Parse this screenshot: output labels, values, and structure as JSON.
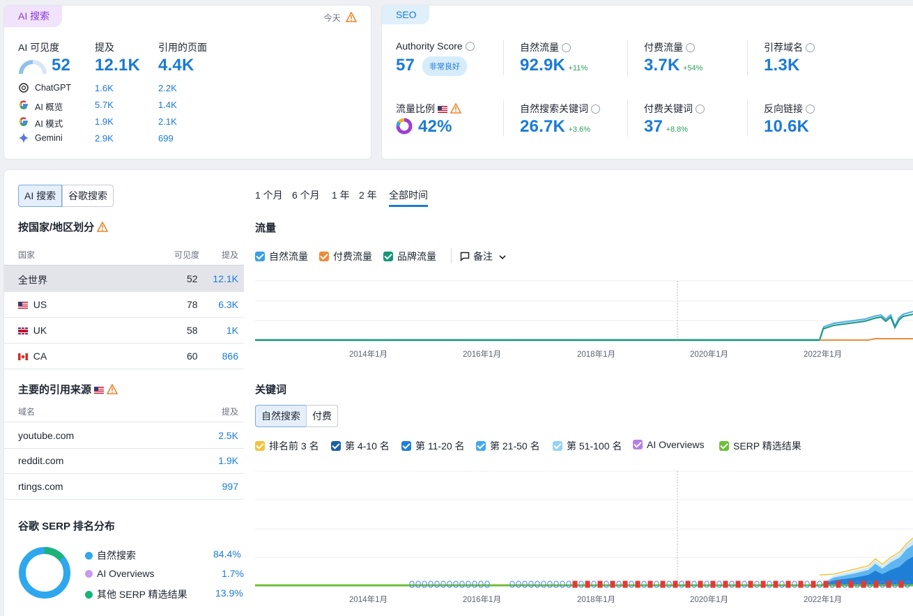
{
  "ai_card": {
    "tag": "AI 搜索",
    "today": "今天",
    "metrics": [
      {
        "label": "AI 可见度",
        "value": "52"
      },
      {
        "label": "提及",
        "value": "12.1K"
      },
      {
        "label": "引用的页面",
        "value": "4.4K"
      }
    ],
    "visibility_gauge_fraction": 0.52,
    "platforms": [
      {
        "icon": "chatgpt-icon",
        "name": "ChatGPT",
        "mentions": "1.6K",
        "pages": "2.2K"
      },
      {
        "icon": "google-icon",
        "name": "AI 概览",
        "mentions": "5.7K",
        "pages": "1.4K"
      },
      {
        "icon": "google-icon",
        "name": "AI 模式",
        "mentions": "1.9K",
        "pages": "2.1K"
      },
      {
        "icon": "gemini-icon",
        "name": "Gemini",
        "mentions": "2.9K",
        "pages": "699"
      }
    ]
  },
  "seo_card": {
    "tag": "SEO",
    "authority_label": "Authority Score",
    "authority_value": "57",
    "authority_badge": "非常良好",
    "organic_label": "自然流量",
    "organic_value": "92.9K",
    "organic_change": "+11%",
    "paid_label": "付费流量",
    "paid_value": "3.7K",
    "paid_change": "+54%",
    "ref_domains_label": "引荐域名",
    "ref_domains_value": "1.3K",
    "traffic_share_label": "流量比例",
    "traffic_share_value": "42%",
    "organic_kw_label": "自然搜索关键词",
    "organic_kw_value": "26.7K",
    "organic_kw_change": "+3.6%",
    "paid_kw_label": "付费关键词",
    "paid_kw_value": "37",
    "paid_kw_change": "+8.8%",
    "backlinks_label": "反向链接",
    "backlinks_value": "10.6K"
  },
  "left_panel": {
    "toggle": [
      "AI 搜索",
      "谷歌搜索"
    ],
    "country_title": "按国家/地区划分",
    "country_headers": {
      "country": "国家",
      "visibility": "可见度",
      "mentions": "提及"
    },
    "countries": [
      {
        "flag": "",
        "name": "全世界",
        "visibility": "52",
        "mentions": "12.1K"
      },
      {
        "flag": "us",
        "name": "US",
        "visibility": "78",
        "mentions": "6.3K"
      },
      {
        "flag": "uk",
        "name": "UK",
        "visibility": "58",
        "mentions": "1K"
      },
      {
        "flag": "ca",
        "name": "CA",
        "visibility": "60",
        "mentions": "866"
      }
    ],
    "sources_title": "主要的引用来源",
    "sources_headers": {
      "domain": "域名",
      "mentions": "提及"
    },
    "sources": [
      {
        "domain": "youtube.com",
        "mentions": "2.5K"
      },
      {
        "domain": "reddit.com",
        "mentions": "1.9K"
      },
      {
        "domain": "rtings.com",
        "mentions": "997"
      }
    ],
    "serp_title": "谷歌 SERP 排名分布",
    "serp_items": [
      {
        "label": "自然搜索",
        "value": "84.4%",
        "color": "#2ea7ef"
      },
      {
        "label": "AI Overviews",
        "value": "1.7%",
        "color": "#c79af0"
      },
      {
        "label": "其他 SERP 精选结果",
        "value": "13.9%",
        "color": "#1ab37a"
      }
    ]
  },
  "periods": [
    "1 个月",
    "6 个月",
    "1 年",
    "2 年",
    "全部时间"
  ],
  "active_period": "全部时间",
  "traffic": {
    "title": "流量",
    "legend": [
      {
        "label": "自然流量",
        "color": "#3aa0e6"
      },
      {
        "label": "付费流量",
        "color": "#f08b3a"
      },
      {
        "label": "品牌流量",
        "color": "#16967a"
      }
    ],
    "notes_label": "备注"
  },
  "keywords": {
    "title": "关键词",
    "toggle": [
      "自然搜索",
      "付费"
    ],
    "legend": [
      {
        "label": "排名前 3 名",
        "color": "#f4c33d"
      },
      {
        "label": "第 4-10 名",
        "color": "#1a5fa8"
      },
      {
        "label": "第 11-20 名",
        "color": "#1f7fd6"
      },
      {
        "label": "第 21-50 名",
        "color": "#45a9ee"
      },
      {
        "label": "第 51-100 名",
        "color": "#95d2f7"
      },
      {
        "label": "AI Overviews",
        "color": "#b57fe9"
      },
      {
        "label": "SERP 精选结果",
        "color": "#6dbf3a"
      }
    ]
  },
  "x_ticks": [
    "2014年1月",
    "2016年1月",
    "2018年1月",
    "2020年1月",
    "2022年1月"
  ]
}
